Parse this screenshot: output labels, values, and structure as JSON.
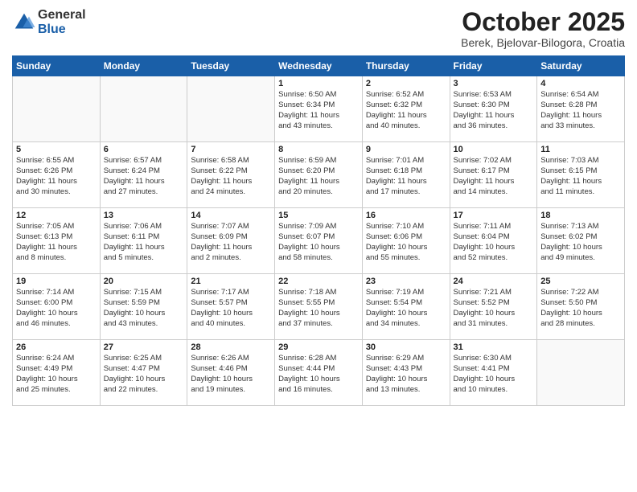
{
  "header": {
    "logo_general": "General",
    "logo_blue": "Blue",
    "month_title": "October 2025",
    "location": "Berek, Bjelovar-Bilogora, Croatia"
  },
  "weekdays": [
    "Sunday",
    "Monday",
    "Tuesday",
    "Wednesday",
    "Thursday",
    "Friday",
    "Saturday"
  ],
  "weeks": [
    [
      {
        "day": "",
        "info": ""
      },
      {
        "day": "",
        "info": ""
      },
      {
        "day": "",
        "info": ""
      },
      {
        "day": "1",
        "info": "Sunrise: 6:50 AM\nSunset: 6:34 PM\nDaylight: 11 hours\nand 43 minutes."
      },
      {
        "day": "2",
        "info": "Sunrise: 6:52 AM\nSunset: 6:32 PM\nDaylight: 11 hours\nand 40 minutes."
      },
      {
        "day": "3",
        "info": "Sunrise: 6:53 AM\nSunset: 6:30 PM\nDaylight: 11 hours\nand 36 minutes."
      },
      {
        "day": "4",
        "info": "Sunrise: 6:54 AM\nSunset: 6:28 PM\nDaylight: 11 hours\nand 33 minutes."
      }
    ],
    [
      {
        "day": "5",
        "info": "Sunrise: 6:55 AM\nSunset: 6:26 PM\nDaylight: 11 hours\nand 30 minutes."
      },
      {
        "day": "6",
        "info": "Sunrise: 6:57 AM\nSunset: 6:24 PM\nDaylight: 11 hours\nand 27 minutes."
      },
      {
        "day": "7",
        "info": "Sunrise: 6:58 AM\nSunset: 6:22 PM\nDaylight: 11 hours\nand 24 minutes."
      },
      {
        "day": "8",
        "info": "Sunrise: 6:59 AM\nSunset: 6:20 PM\nDaylight: 11 hours\nand 20 minutes."
      },
      {
        "day": "9",
        "info": "Sunrise: 7:01 AM\nSunset: 6:18 PM\nDaylight: 11 hours\nand 17 minutes."
      },
      {
        "day": "10",
        "info": "Sunrise: 7:02 AM\nSunset: 6:17 PM\nDaylight: 11 hours\nand 14 minutes."
      },
      {
        "day": "11",
        "info": "Sunrise: 7:03 AM\nSunset: 6:15 PM\nDaylight: 11 hours\nand 11 minutes."
      }
    ],
    [
      {
        "day": "12",
        "info": "Sunrise: 7:05 AM\nSunset: 6:13 PM\nDaylight: 11 hours\nand 8 minutes."
      },
      {
        "day": "13",
        "info": "Sunrise: 7:06 AM\nSunset: 6:11 PM\nDaylight: 11 hours\nand 5 minutes."
      },
      {
        "day": "14",
        "info": "Sunrise: 7:07 AM\nSunset: 6:09 PM\nDaylight: 11 hours\nand 2 minutes."
      },
      {
        "day": "15",
        "info": "Sunrise: 7:09 AM\nSunset: 6:07 PM\nDaylight: 10 hours\nand 58 minutes."
      },
      {
        "day": "16",
        "info": "Sunrise: 7:10 AM\nSunset: 6:06 PM\nDaylight: 10 hours\nand 55 minutes."
      },
      {
        "day": "17",
        "info": "Sunrise: 7:11 AM\nSunset: 6:04 PM\nDaylight: 10 hours\nand 52 minutes."
      },
      {
        "day": "18",
        "info": "Sunrise: 7:13 AM\nSunset: 6:02 PM\nDaylight: 10 hours\nand 49 minutes."
      }
    ],
    [
      {
        "day": "19",
        "info": "Sunrise: 7:14 AM\nSunset: 6:00 PM\nDaylight: 10 hours\nand 46 minutes."
      },
      {
        "day": "20",
        "info": "Sunrise: 7:15 AM\nSunset: 5:59 PM\nDaylight: 10 hours\nand 43 minutes."
      },
      {
        "day": "21",
        "info": "Sunrise: 7:17 AM\nSunset: 5:57 PM\nDaylight: 10 hours\nand 40 minutes."
      },
      {
        "day": "22",
        "info": "Sunrise: 7:18 AM\nSunset: 5:55 PM\nDaylight: 10 hours\nand 37 minutes."
      },
      {
        "day": "23",
        "info": "Sunrise: 7:19 AM\nSunset: 5:54 PM\nDaylight: 10 hours\nand 34 minutes."
      },
      {
        "day": "24",
        "info": "Sunrise: 7:21 AM\nSunset: 5:52 PM\nDaylight: 10 hours\nand 31 minutes."
      },
      {
        "day": "25",
        "info": "Sunrise: 7:22 AM\nSunset: 5:50 PM\nDaylight: 10 hours\nand 28 minutes."
      }
    ],
    [
      {
        "day": "26",
        "info": "Sunrise: 6:24 AM\nSunset: 4:49 PM\nDaylight: 10 hours\nand 25 minutes."
      },
      {
        "day": "27",
        "info": "Sunrise: 6:25 AM\nSunset: 4:47 PM\nDaylight: 10 hours\nand 22 minutes."
      },
      {
        "day": "28",
        "info": "Sunrise: 6:26 AM\nSunset: 4:46 PM\nDaylight: 10 hours\nand 19 minutes."
      },
      {
        "day": "29",
        "info": "Sunrise: 6:28 AM\nSunset: 4:44 PM\nDaylight: 10 hours\nand 16 minutes."
      },
      {
        "day": "30",
        "info": "Sunrise: 6:29 AM\nSunset: 4:43 PM\nDaylight: 10 hours\nand 13 minutes."
      },
      {
        "day": "31",
        "info": "Sunrise: 6:30 AM\nSunset: 4:41 PM\nDaylight: 10 hours\nand 10 minutes."
      },
      {
        "day": "",
        "info": ""
      }
    ]
  ]
}
